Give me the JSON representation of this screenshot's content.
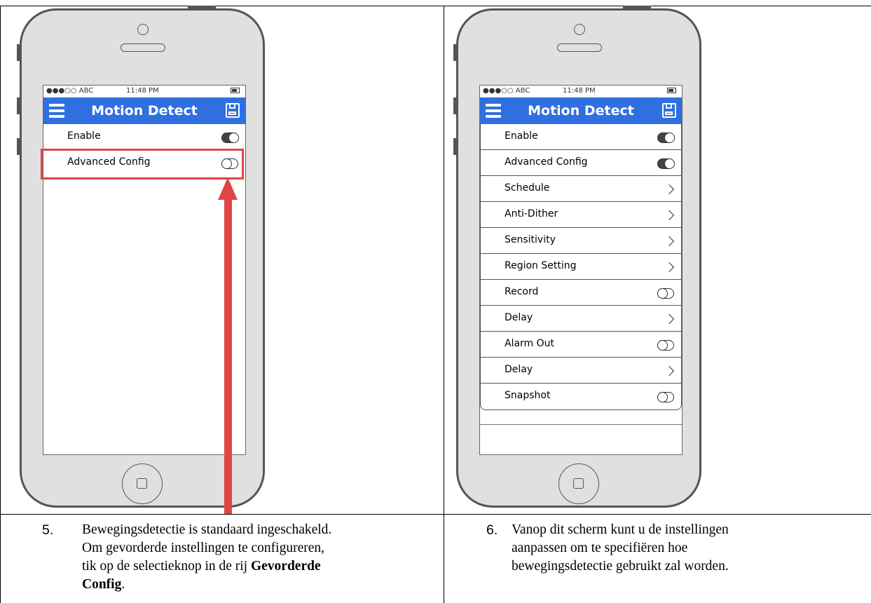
{
  "phone_left": {
    "status": {
      "carrier": "●●●○○ ABC",
      "time": "11:48 PM"
    },
    "title": "Motion Detect",
    "rows": [
      {
        "label": "Enable",
        "control": "toggle-on"
      },
      {
        "label": "Advanced Config",
        "control": "toggle-off",
        "highlighted": true
      }
    ]
  },
  "phone_right": {
    "status": {
      "carrier": "●●●○○ ABC",
      "time": "11:48 PM"
    },
    "title": "Motion Detect",
    "rows": [
      {
        "label": "Enable",
        "control": "toggle-on"
      },
      {
        "label": "Advanced Config",
        "control": "toggle-on"
      },
      {
        "label": "Schedule",
        "control": "chevron"
      },
      {
        "label": "Anti-Dither",
        "control": "chevron"
      },
      {
        "label": "Sensitivity",
        "control": "chevron"
      },
      {
        "label": "Region Setting",
        "control": "chevron"
      },
      {
        "label": "Record",
        "control": "toggle-off"
      },
      {
        "label": "Delay",
        "control": "chevron"
      },
      {
        "label": "Alarm Out",
        "control": "toggle-off"
      },
      {
        "label": "Delay",
        "control": "chevron"
      },
      {
        "label": "Snapshot",
        "control": "toggle-off"
      }
    ]
  },
  "captions": {
    "left": {
      "number": "5.",
      "line1": "Bewegingsdetectie is standaard ingeschakeld.",
      "line2": "Om gevorderde instellingen te configureren,",
      "line3_pre": "tik op de selectieknop in de rij ",
      "line3_bold": "Gevorderde",
      "line4_bold": "Config",
      "line4_post": "."
    },
    "right": {
      "number": "6.",
      "line1": "Vanop dit scherm kunt u de instellingen",
      "line2": "aanpassen om te specifiëren hoe",
      "line3": "bewegingsdetectie gebruikt zal worden."
    }
  },
  "colors": {
    "accent": "#2f6fe0",
    "highlight": "#e04545",
    "phone_body": "#e0e0e0"
  },
  "icons": [
    "hamburger-icon",
    "save-icon",
    "chevron-right-icon",
    "toggle-icon",
    "home-button-icon"
  ]
}
